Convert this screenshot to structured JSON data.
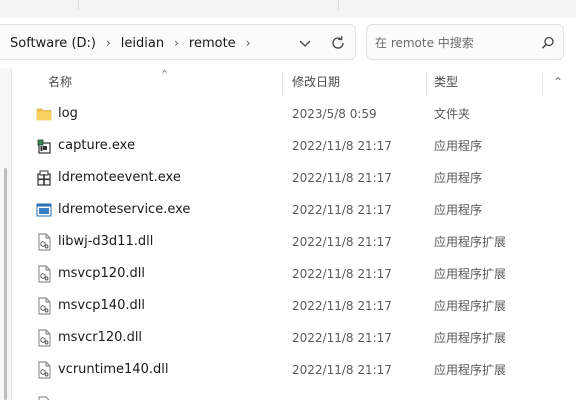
{
  "address": {
    "crumbs": [
      "Software (D:)",
      "leidian",
      "remote"
    ],
    "separator": "›"
  },
  "search": {
    "placeholder": "在 remote 中搜索"
  },
  "columns": {
    "name": "名称",
    "date": "修改日期",
    "type": "类型"
  },
  "files": [
    {
      "name": "log",
      "date": "2023/5/8 0:59",
      "type": "文件夹",
      "icon": "folder-icon"
    },
    {
      "name": "capture.exe",
      "date": "2022/11/8 21:17",
      "type": "应用程序",
      "icon": "app-icon"
    },
    {
      "name": "ldremoteevent.exe",
      "date": "2022/11/8 21:17",
      "type": "应用程序",
      "icon": "app-icon"
    },
    {
      "name": "ldremoteservice.exe",
      "date": "2022/11/8 21:17",
      "type": "应用程序",
      "icon": "window-app-icon"
    },
    {
      "name": "libwj-d3d11.dll",
      "date": "2022/11/8 21:17",
      "type": "应用程序扩展",
      "icon": "dll-icon"
    },
    {
      "name": "msvcp120.dll",
      "date": "2022/11/8 21:17",
      "type": "应用程序扩展",
      "icon": "dll-icon"
    },
    {
      "name": "msvcp140.dll",
      "date": "2022/11/8 21:17",
      "type": "应用程序扩展",
      "icon": "dll-icon"
    },
    {
      "name": "msvcr120.dll",
      "date": "2022/11/8 21:17",
      "type": "应用程序扩展",
      "icon": "dll-icon"
    },
    {
      "name": "vcruntime140.dll",
      "date": "2022/11/8 21:17",
      "type": "应用程序扩展",
      "icon": "dll-icon"
    }
  ],
  "colors": {
    "folder": "#f2c14e",
    "accent": "#2f6fb2"
  }
}
